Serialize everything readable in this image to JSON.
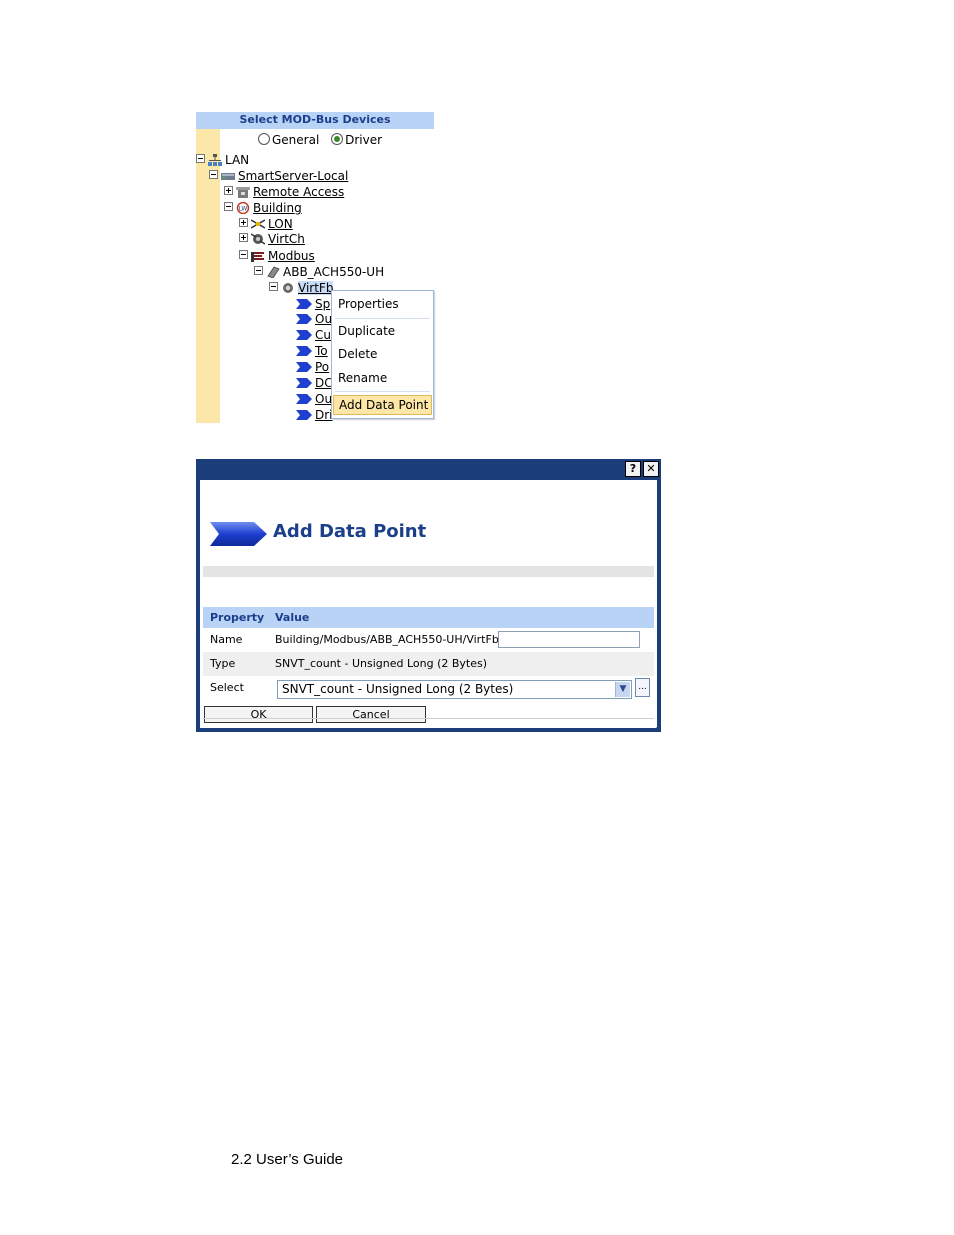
{
  "tree_panel": {
    "header": "Select MOD-Bus Devices",
    "mode": {
      "options": [
        "General",
        "Driver"
      ],
      "selected": "Driver"
    },
    "nodes": {
      "lan": "LAN",
      "smartserver": "SmartServer-Local",
      "remote_access": "Remote Access",
      "building": "Building",
      "lon": "LON",
      "virtch": "VirtCh",
      "modbus": "Modbus",
      "device": "ABB_ACH550-UH",
      "virtfb": "VirtFb"
    },
    "data_points": [
      "Sp",
      "Ou",
      "Cu",
      "To",
      "Po",
      "DC",
      "Ou",
      "Dri"
    ]
  },
  "context_menu": {
    "items": [
      "Properties",
      "Duplicate",
      "Delete",
      "Rename",
      "Add Data Point"
    ],
    "highlighted": "Add Data Point"
  },
  "dialog": {
    "help_button": "?",
    "close_button": "✕",
    "title": "Add Data Point",
    "table": {
      "headers": {
        "property": "Property",
        "value": "Value"
      },
      "name_label": "Name",
      "name_value": "Building/Modbus/ABB_ACH550-UH/VirtFb/",
      "name_input": "",
      "type_label": "Type",
      "type_value": "SNVT_count - Unsigned Long (2 Bytes)",
      "select_label": "Select",
      "select_value": "SNVT_count - Unsigned Long (2 Bytes)",
      "browse_label": "..."
    },
    "ok_label": "OK",
    "cancel_label": "Cancel"
  },
  "footer": "2.2 User’s Guide",
  "colors": {
    "header_blue": "#b9d3f7",
    "gutter_yellow": "#fbe7a8",
    "dialog_frame": "#1b3d7a",
    "title_text": "#1b3f8a",
    "menu_highlight": "#fde6a6"
  }
}
